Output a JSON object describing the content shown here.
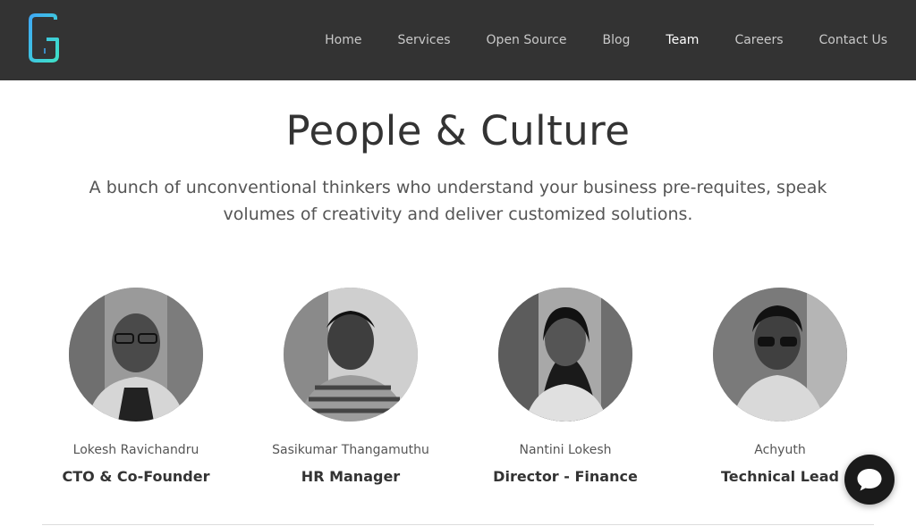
{
  "colors": {
    "nav_background": "#333333",
    "nav_text": "#c9c9c9",
    "nav_active_text": "#ffffff",
    "logo_gradient_start": "#3fa9f5",
    "logo_gradient_end": "#3ee0c8",
    "chat_button": "#1a1a1a"
  },
  "nav": {
    "logo_icon": "g-logo-icon",
    "items": [
      {
        "label": "Home",
        "active": false
      },
      {
        "label": "Services",
        "active": false
      },
      {
        "label": "Open Source",
        "active": false
      },
      {
        "label": "Blog",
        "active": false
      },
      {
        "label": "Team",
        "active": true
      },
      {
        "label": "Careers",
        "active": false
      },
      {
        "label": "Contact Us",
        "active": false
      }
    ]
  },
  "hero": {
    "title": "People & Culture",
    "subtitle": "A bunch of unconventional thinkers who understand your business pre-requites, speak volumes of creativity and deliver customized solutions."
  },
  "team": [
    {
      "name": "Lokesh Ravichandru",
      "role": "CTO & Co-Founder"
    },
    {
      "name": "Sasikumar Thangamuthu",
      "role": "HR Manager"
    },
    {
      "name": "Nantini Lokesh",
      "role": "Director - Finance"
    },
    {
      "name": "Achyuth",
      "role": "Technical Lead"
    }
  ],
  "chat": {
    "icon": "chat-bubble-icon"
  }
}
